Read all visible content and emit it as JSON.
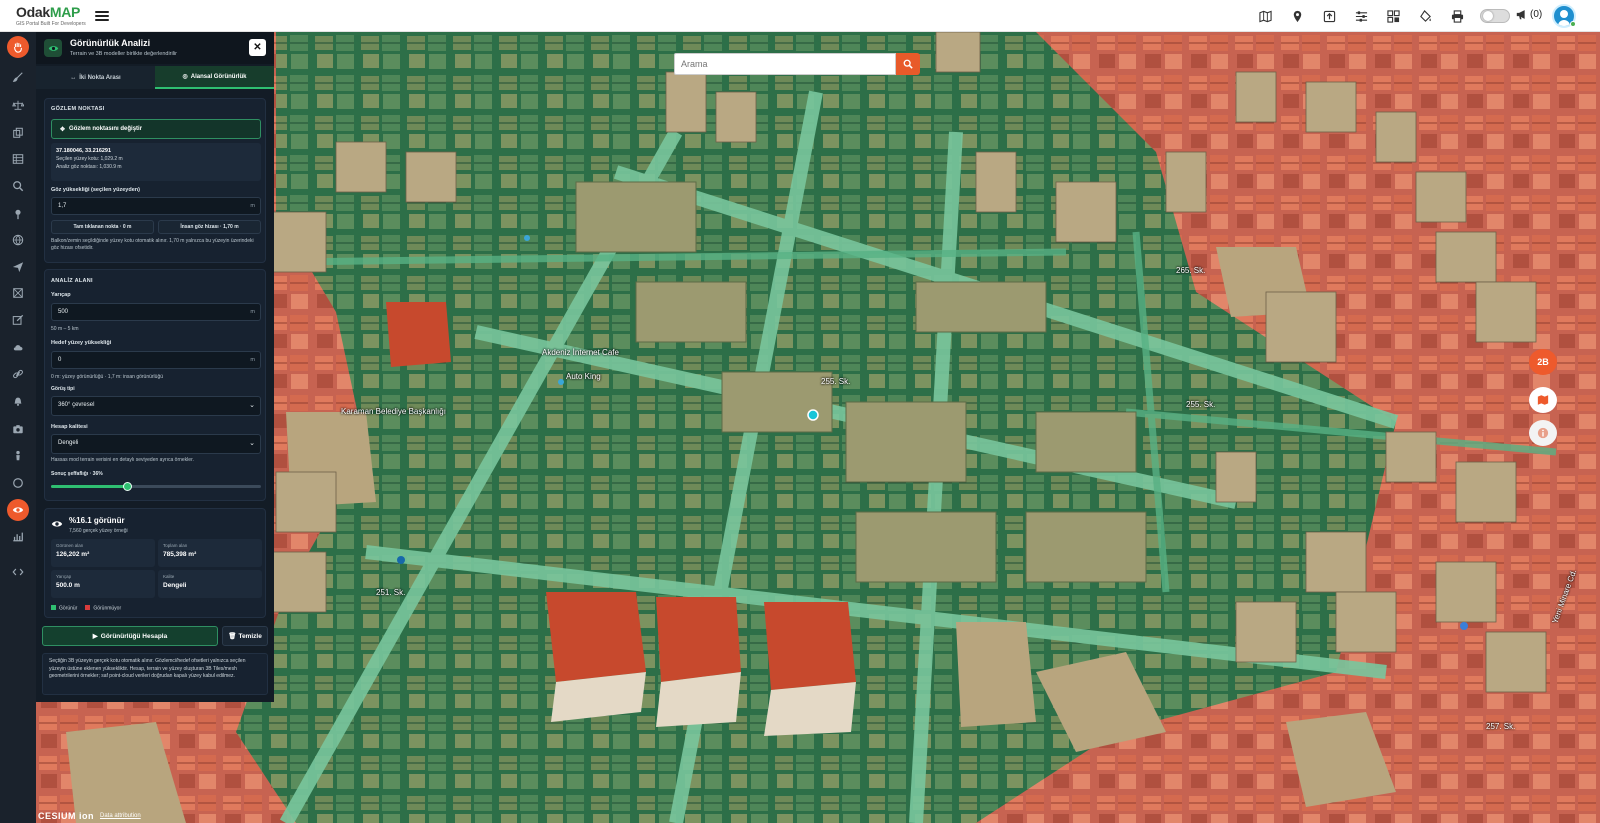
{
  "header": {
    "logo_part1": "Odak",
    "logo_part2": "MAP",
    "logo_tagline": "GIS Portal Built For Developers",
    "notification_count": "(0)",
    "icons": [
      "map-layers-icon",
      "location-pin-icon",
      "upload-icon",
      "sliders-icon",
      "dashboard-icon",
      "fill-drip-icon",
      "printer-icon"
    ]
  },
  "colors": {
    "accent_orange": "#ee5a2c",
    "panel_bg": "#131c26",
    "visible_green": "#2fbf71",
    "hidden_red": "#d83c3c"
  },
  "left_rail": {
    "icons": [
      "hand-icon",
      "brush-icon",
      "scale-icon",
      "copy-icon",
      "table-icon",
      "search-icon",
      "pin-icon",
      "globe-icon",
      "send-icon",
      "shapes-icon",
      "edit-icon",
      "cloud-icon",
      "link-icon",
      "bell-icon",
      "camera-icon",
      "person-icon",
      "circle-icon",
      "eye-icon",
      "chart-icon",
      "code-icon"
    ],
    "active_index": 17
  },
  "map": {
    "search_placeholder": "Arama",
    "view_mode_label": "2B",
    "street_labels": [
      "255. Sk.",
      "255. Sk.",
      "251. Sk.",
      "Akdeniz İnternet Cafe",
      "Auto King",
      "Karaman Belediye Başkanlığı",
      "Yeni Minare Cd.",
      "265. Sk.",
      "257. Sk."
    ],
    "attribution_brand": "CESIUM ion",
    "attribution_link": "Data attribution"
  },
  "panel": {
    "title": "Görünürlük Analizi",
    "subtitle": "Terrain ve 3B modeller birlikte değerlendirilir",
    "tabs": [
      {
        "label": "İki Nokta Arası",
        "active": false
      },
      {
        "label": "Alansal Görünürlük",
        "active": true
      }
    ],
    "observation": {
      "section_title": "GÖZLEM NOKTASI",
      "change_button": "Gözlem noktasını değiştir",
      "coords": "37.180046, 33.216291",
      "surface_height": "Seçilen yüzey kotu: 1,029.2 m",
      "eye_point": "Analiz göz noktası: 1,030.9 m",
      "eye_height_label": "Göz yüksekliği (seçilen yüzeyden)",
      "eye_height_value": "1,7",
      "unit_m": "m",
      "preset_1": "Tam tıklanan nokta · 0 m",
      "preset_2": "İnsan göz hizası · 1,70 m",
      "note": "Balkon/zemin seçildiğinde yüzey kotu otomatik alınır. 1,70 m yalnızca bu yüzeyin üzerindeki göz hizası ofsetidir."
    },
    "analysis": {
      "section_title": "ANALİZ ALANI",
      "radius_label": "Yarıçap",
      "radius_value": "500",
      "radius_hint": "50 m – 5 km",
      "target_label": "Hedef yüzey yüksekliği",
      "target_value": "0",
      "target_hint": "0 m: yüzey görünürlüğü · 1,7 m: insan görünürlüğü",
      "viewtype_label": "Görüş tipi",
      "viewtype_value": "360° çevresel",
      "quality_label": "Hesap kalitesi",
      "quality_value": "Dengeli",
      "quality_note": "Hassas mod terrain verisini en detaylı seviyeden ayrıca örnekler.",
      "transparency_label": "Sonuç şeffaflığı · 36%",
      "transparency": 0.36
    },
    "result": {
      "title": "%16.1 görünür",
      "subtitle": "7,560 gerçek yüzey örneği",
      "stats": [
        {
          "key": "Görünen alan",
          "value": "126,202 m²"
        },
        {
          "key": "Toplam alan",
          "value": "785,398 m²"
        },
        {
          "key": "Yarıçap",
          "value": "500.0 m"
        },
        {
          "key": "Kalite",
          "value": "Dengeli"
        }
      ],
      "legend_visible": "Görünür",
      "legend_hidden": "Görünmüyor"
    },
    "actions": {
      "calculate": "Görünürlüğü Hesapla",
      "clear": "Temizle"
    },
    "info_text": "Seçtiğin 3B yüzeyin gerçek kotu otomatik alınır. Gözlemci/hedef ofsetleri yalnızca seçilen yüzeyin üstüne eklenen yüksekliktir. Hesap, terrain ve yüzey oluşturan 3B Tiles/mesh geometrilerini örnekler; saf point-cloud verileri doğrudan kapalı yüzey kabul edilmez."
  }
}
